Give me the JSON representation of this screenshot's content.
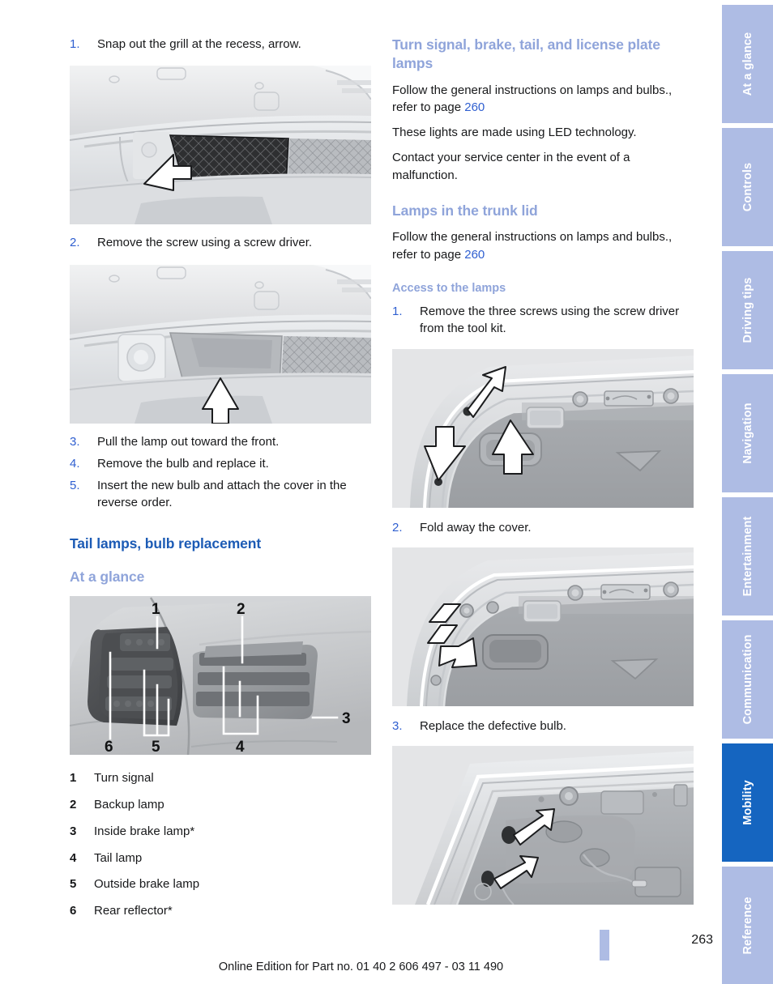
{
  "document": {
    "page_number": "263",
    "edition_line": "Online Edition for Part no. 01 40 2 606 497 - 03 11 490"
  },
  "left_column": {
    "steps_front_lamp": [
      {
        "num": "1.",
        "text": "Snap out the grill at the recess, arrow."
      },
      {
        "num": "2.",
        "text": "Remove the screw using a screw driver."
      },
      {
        "num": "3.",
        "text": "Pull the lamp out toward the front."
      },
      {
        "num": "4.",
        "text": "Remove the bulb and replace it."
      },
      {
        "num": "5.",
        "text": "Insert the new bulb and attach the cover in the reverse order."
      }
    ],
    "figure_1_caption": "Front bumper grill with arrow at recess",
    "figure_2_caption": "Front bumper with arrow pointing at screw",
    "heading_tail_lamps": "Tail lamps, bulb replacement",
    "heading_at_a_glance": "At a glance",
    "figure_3_caption": "Tail lamp assembly with callouts 1 to 6",
    "legend": [
      {
        "num": "1",
        "label": "Turn signal"
      },
      {
        "num": "2",
        "label": "Backup lamp"
      },
      {
        "num": "3",
        "label": "Inside brake lamp*"
      },
      {
        "num": "4",
        "label": "Tail lamp"
      },
      {
        "num": "5",
        "label": "Outside brake lamp"
      },
      {
        "num": "6",
        "label": "Rear reflector*"
      }
    ]
  },
  "right_column": {
    "heading_turn_signal": "Turn signal, brake, tail, and license plate lamps",
    "para_1_before": "Follow the general instructions on lamps and bulbs., refer to page ",
    "para_1_ref": "260",
    "para_2": "These lights are made using LED technology.",
    "para_3": "Contact your service center in the event of a malfunction.",
    "heading_trunk_lid": "Lamps in the trunk lid",
    "para_4_before": "Follow the general instructions on lamps and bulbs., refer to page ",
    "para_4_ref": "260",
    "heading_access": "Access to the lamps",
    "steps_trunk": [
      {
        "num": "1.",
        "text": "Remove the three screws using the screw driver from the tool kit."
      },
      {
        "num": "2.",
        "text": "Fold away the cover."
      },
      {
        "num": "3.",
        "text": "Replace the defective bulb."
      }
    ],
    "figure_4_caption": "Trunk lid interior with three arrows at screws",
    "figure_5_caption": "Trunk lid with arrow pointing at cover",
    "figure_6_caption": "Trunk lid with two arrows at bulb holders"
  },
  "side_tabs": [
    {
      "label": "At a glance",
      "active": false
    },
    {
      "label": "Controls",
      "active": false
    },
    {
      "label": "Driving tips",
      "active": false
    },
    {
      "label": "Navigation",
      "active": false
    },
    {
      "label": "Entertainment",
      "active": false
    },
    {
      "label": "Communication",
      "active": false
    },
    {
      "label": "Mobility",
      "active": true
    },
    {
      "label": "Reference",
      "active": false
    }
  ],
  "colors": {
    "heading_dark_blue": "#1c5bb5",
    "heading_light_blue": "#8fa4da",
    "page_reference_link": "#2f5fd0",
    "tab_inactive": "#aebce4",
    "tab_active": "#1565c0",
    "body_text": "#17181a"
  }
}
